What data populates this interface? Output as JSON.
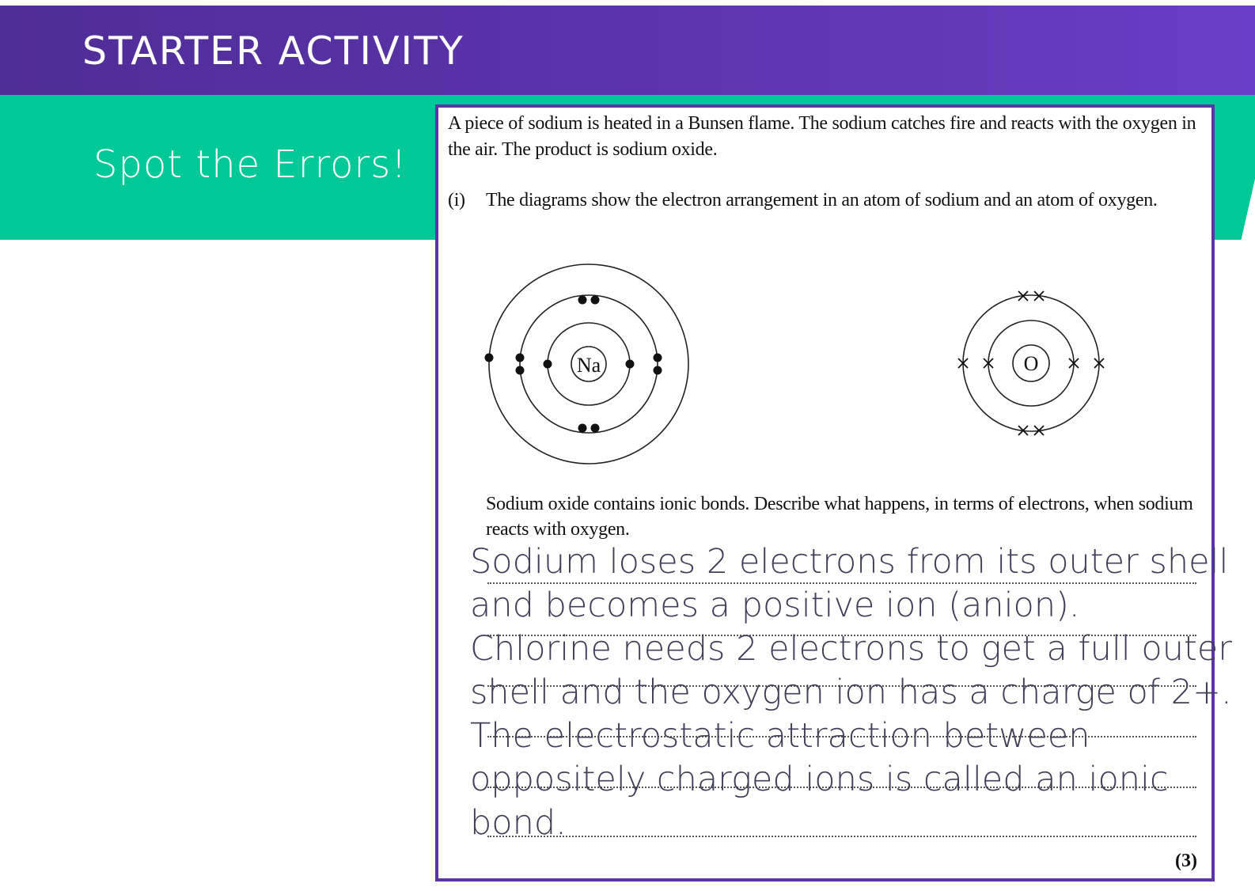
{
  "header": {
    "title": "STARTER ACTIVITY",
    "subtitle": "Spot the Errors!"
  },
  "colors": {
    "title_bar": "#5c35ae",
    "green_band": "#00c896",
    "panel_border": "#5e35a6"
  },
  "question": {
    "intro": "A piece of sodium is heated in a Bunsen flame.  The sodium catches fire and reacts with the oxygen in the air.  The product is sodium oxide.",
    "part_number": "(i)",
    "part_text": "The diagrams show the electron arrangement in an atom of sodium and an atom of oxygen.",
    "prompt": "Sodium oxide contains ionic bonds.  Describe what happens, in terms of electrons, when sodium reacts with oxygen.",
    "marks": "(3)"
  },
  "diagrams": {
    "sodium": {
      "label": "Na",
      "shells": [
        2,
        8,
        1
      ]
    },
    "oxygen": {
      "label": "O",
      "shells": [
        2,
        6
      ]
    }
  },
  "answer": {
    "lines": [
      "Sodium loses 2 electrons from its outer shell",
      "and becomes a positive ion (anion).",
      "Chlorine needs 2 electrons to get a full outer",
      "shell and the oxygen ion has a charge of 2+.",
      "The electrostatic attraction between",
      "oppositely charged ions is called an ionic",
      "bond."
    ]
  }
}
